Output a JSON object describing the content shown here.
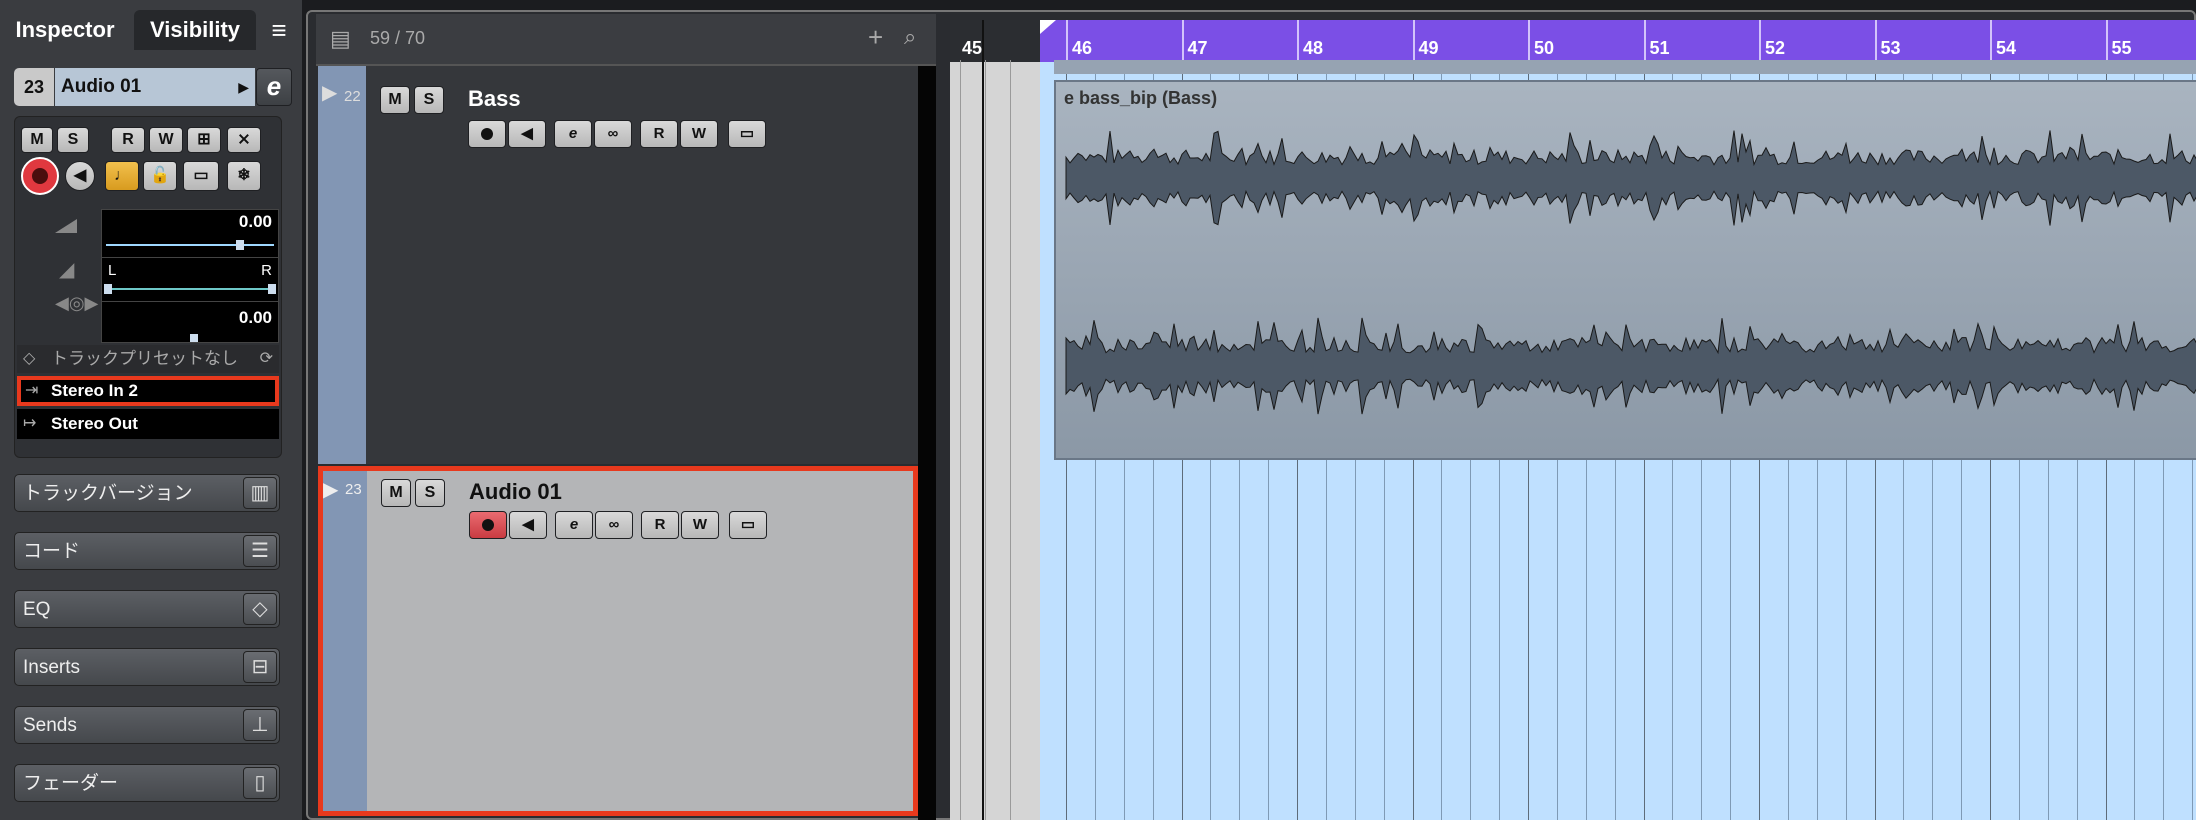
{
  "inspector": {
    "tabs": [
      "Inspector",
      "Visibility"
    ],
    "menu_icon": "≡",
    "track_number": "23",
    "track_name": "Audio 01",
    "edit_icon": "e",
    "buttons_row1": [
      "M",
      "S",
      "R",
      "W"
    ],
    "volume_value": "0.00",
    "pan_left": "L",
    "pan_right": "R",
    "delay_value": "0.00",
    "preset_label": "トラックプリセットなし",
    "input_routing": "Stereo In 2",
    "output_routing": "Stereo Out",
    "sections": [
      "トラックバージョン",
      "コード",
      "EQ",
      "Inserts",
      "Sends",
      "フェーダー"
    ]
  },
  "tracklist": {
    "counter": "59 / 70",
    "tracks": [
      {
        "number": "22",
        "name": "Bass"
      },
      {
        "number": "23",
        "name": "Audio 01"
      }
    ],
    "buttons": [
      "M",
      "S",
      "R",
      "W"
    ]
  },
  "ruler": {
    "bars": [
      "45",
      "46",
      "47",
      "48",
      "49",
      "50",
      "51",
      "52",
      "53",
      "54",
      "55"
    ]
  },
  "clip": {
    "title": "e bass_bip (Bass)"
  },
  "colors": {
    "ruler_accent": "#7b4fe6",
    "highlight": "#e8391d",
    "record": "#e0383f"
  }
}
